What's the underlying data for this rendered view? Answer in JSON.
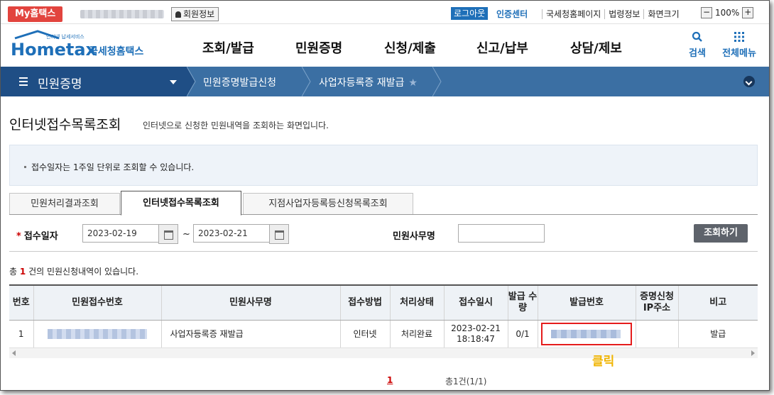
{
  "topbar": {
    "my_hometax": "My홈택스",
    "member_info": "회원정보",
    "logout": "로그아웃",
    "cert_center": "인증센터",
    "links": [
      "국세청홈페이지",
      "법령정보",
      "화면크기"
    ],
    "zoom_minus": "−",
    "zoom_value": "100%",
    "zoom_plus": "+"
  },
  "header": {
    "logo_small": "인터넷 납세서비스",
    "logo_main": "Hometax",
    "logo_kr": "국세청홈택스",
    "nav": [
      "조회/발급",
      "민원증명",
      "신청/제출",
      "신고/납부",
      "상담/제보"
    ],
    "search_label": "검색",
    "menu_label": "전체메뉴"
  },
  "breadcrumb": {
    "main": "민원증명",
    "items": [
      "민원증명발급신청",
      "사업자등록증 재발급"
    ]
  },
  "page": {
    "title": "인터넷접수목록조회",
    "description": "인터넷으로 신청한 민원내역을 조회하는 화면입니다.",
    "notice": "접수일자는 1주일 단위로 조회할 수 있습니다."
  },
  "tabs": [
    "민원처리결과조회",
    "인터넷접수목록조회",
    "지점사업자등록등신청목록조회"
  ],
  "search": {
    "date_label": "접수일자",
    "required_mark": "*",
    "date_from": "2023-02-19",
    "date_sep": "~",
    "date_to": "2023-02-21",
    "office_label": "민원사무명",
    "office_value": "",
    "query_button": "조회하기"
  },
  "result": {
    "prefix": "총",
    "count": "1",
    "suffix": "건의 민원신청내역이 있습니다."
  },
  "table": {
    "headers": [
      "번호",
      "민원접수번호",
      "민원사무명",
      "접수방법",
      "처리상태",
      "접수일시",
      "발급 수량",
      "발급번호",
      "증명신청 IP주소",
      "비고"
    ],
    "rows": [
      {
        "no": "1",
        "office": "사업자등록증 재발급",
        "method": "인터넷",
        "status": "처리완료",
        "date": "2023-02-21",
        "time": "18:18:47",
        "qty": "0/1",
        "ip": "",
        "note": "발급"
      }
    ]
  },
  "annotation": {
    "click_label": "클릭",
    "highlight_color": "#e51c1c",
    "label_color": "#f0b400"
  },
  "pagination": {
    "current": "1",
    "total": "총1건(1/1)"
  }
}
